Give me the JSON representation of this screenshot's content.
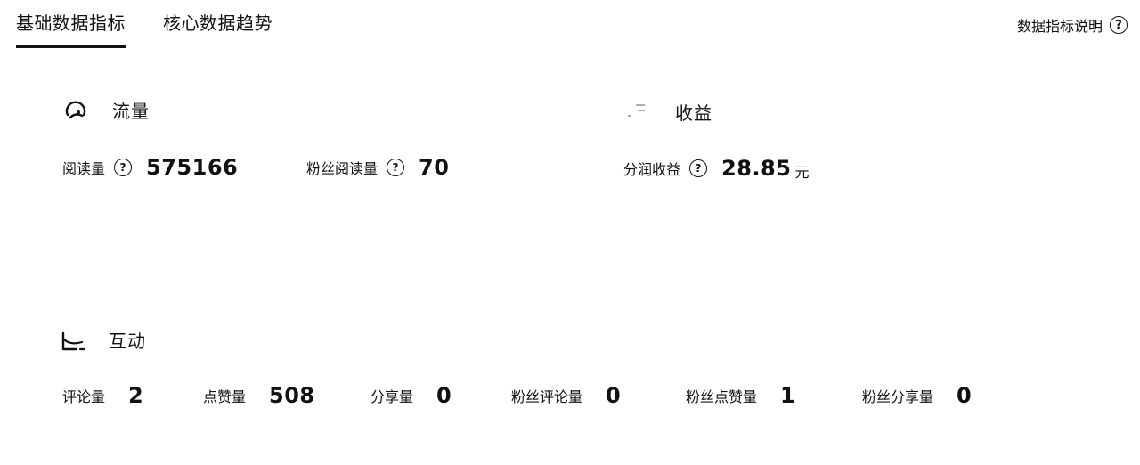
{
  "tabs": [
    {
      "label": "基础数据指标",
      "active": true
    },
    {
      "label": "核心数据趋势",
      "active": false
    }
  ],
  "help_link": {
    "label": "数据指标说明",
    "icon": "question-circle-icon"
  },
  "sections": {
    "traffic": {
      "title": "流量",
      "icon": "traffic-gauge-icon",
      "metrics": [
        {
          "label": "阅读量",
          "value": "575166",
          "has_help": true
        },
        {
          "label": "粉丝阅读量",
          "value": "70",
          "has_help": true
        }
      ]
    },
    "revenue": {
      "title": "收益",
      "icon": "revenue-list-icon",
      "metrics": [
        {
          "label": "分润收益",
          "value": "28.85",
          "unit": "元",
          "has_help": true
        }
      ]
    },
    "interaction": {
      "title": "互动",
      "icon": "interaction-hand-icon",
      "metrics": [
        {
          "label": "评论量",
          "value": "2"
        },
        {
          "label": "点赞量",
          "value": "508"
        },
        {
          "label": "分享量",
          "value": "0"
        },
        {
          "label": "粉丝评论量",
          "value": "0"
        },
        {
          "label": "粉丝点赞量",
          "value": "1"
        },
        {
          "label": "粉丝分享量",
          "value": "0"
        }
      ]
    }
  }
}
